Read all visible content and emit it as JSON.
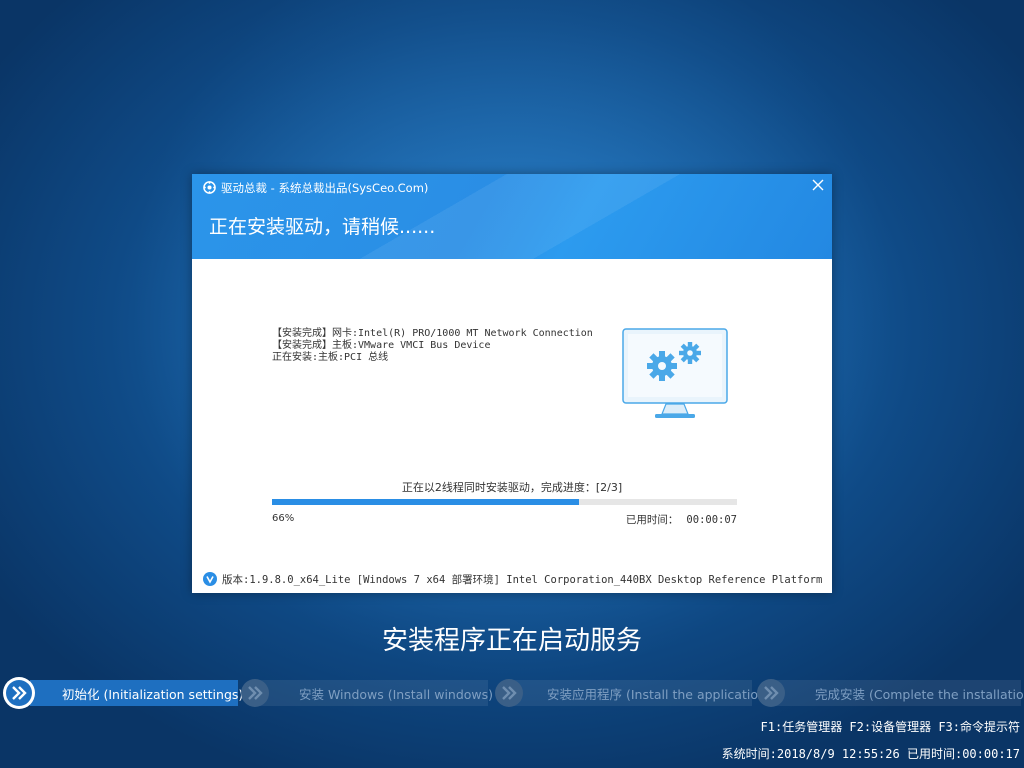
{
  "dialog": {
    "app_title": "驱动总裁 - 系统总裁出品(SysCeo.Com)",
    "status_title": "正在安装驱动，请稍候......",
    "log_lines": [
      "【安装完成】网卡:Intel(R) PRO/1000 MT Network Connection",
      "【安装完成】主板:VMware VMCI Bus Device",
      "正在安装:主板:PCI 总线"
    ],
    "progress_caption": "正在以2线程同时安装驱动，完成进度：[2/3]",
    "progress_percent": 66,
    "percent_text": "66%",
    "elapsed_label": "已用时间：",
    "elapsed_value": "00:00:07",
    "version_text": "版本:1.9.8.0_x64_Lite [Windows 7 x64 部署环境] Intel Corporation_440BX Desktop Reference Platform"
  },
  "main_caption": "安装程序正在启动服务",
  "steps": [
    {
      "label": "初始化 (Initialization settings)",
      "active": true
    },
    {
      "label": "安装 Windows (Install windows)",
      "active": false
    },
    {
      "label": "安装应用程序 (Install the application)",
      "active": false
    },
    {
      "label": "完成安装 (Complete the installation)",
      "active": false
    }
  ],
  "footer": {
    "hotkeys": "F1:任务管理器 F2:设备管理器 F3:命令提示符",
    "system_time_label": "系统时间:",
    "system_time_value": "2018/8/9 12:55:26",
    "elapsed_label": "已用时间:",
    "elapsed_value": "00:00:17"
  },
  "colors": {
    "accent": "#2a8ee5",
    "active_step": "#1e6fc0"
  }
}
